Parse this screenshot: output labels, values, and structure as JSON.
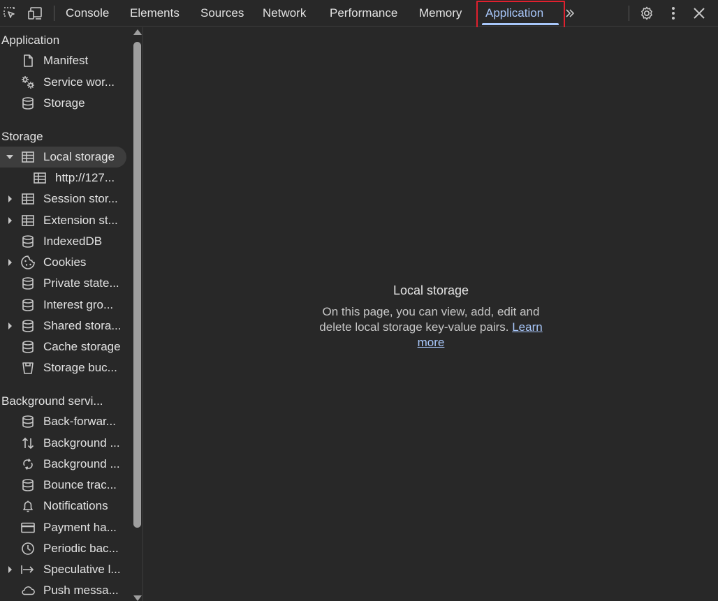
{
  "toolbar": {
    "tabs": [
      {
        "label": "Console"
      },
      {
        "label": "Elements"
      },
      {
        "label": "Sources"
      },
      {
        "label": "Network"
      },
      {
        "label": "Performance"
      },
      {
        "label": "Memory"
      },
      {
        "label": "Application",
        "active": true
      }
    ],
    "icons": {
      "inspect": "inspect-element-icon",
      "device": "device-toolbar-icon",
      "more_tabs": "chevron-double-right-icon",
      "settings": "gear-icon",
      "menu": "kebab-menu-icon",
      "close": "close-icon"
    },
    "accent_color": "#a8c7fa",
    "highlight_color": "#e0202e"
  },
  "sidebar": {
    "sections": [
      {
        "header": "Application",
        "items": [
          {
            "label": "Manifest",
            "icon": "document-icon"
          },
          {
            "label": "Service wor...",
            "icon": "gears-icon"
          },
          {
            "label": "Storage",
            "icon": "database-icon"
          }
        ]
      },
      {
        "header": "Storage",
        "items": [
          {
            "label": "Local storage",
            "icon": "table-icon",
            "expanded": true,
            "selected": true
          },
          {
            "label": "http://127...",
            "icon": "table-icon",
            "child": true
          },
          {
            "label": "Session stor...",
            "icon": "table-icon",
            "collapsed": true
          },
          {
            "label": "Extension st...",
            "icon": "table-icon",
            "collapsed": true
          },
          {
            "label": "IndexedDB",
            "icon": "database-icon"
          },
          {
            "label": "Cookies",
            "icon": "cookie-icon",
            "collapsed": true
          },
          {
            "label": "Private state...",
            "icon": "database-icon"
          },
          {
            "label": "Interest gro...",
            "icon": "database-icon"
          },
          {
            "label": "Shared stora...",
            "icon": "database-icon",
            "collapsed": true
          },
          {
            "label": "Cache storage",
            "icon": "database-icon"
          },
          {
            "label": "Storage buc...",
            "icon": "bucket-icon"
          }
        ]
      },
      {
        "header": "Background servi...",
        "items": [
          {
            "label": "Back-forwar...",
            "icon": "database-icon"
          },
          {
            "label": "Background ...",
            "icon": "up-down-arrows-icon"
          },
          {
            "label": "Background ...",
            "icon": "sync-icon"
          },
          {
            "label": "Bounce trac...",
            "icon": "database-icon"
          },
          {
            "label": "Notifications",
            "icon": "bell-icon"
          },
          {
            "label": "Payment ha...",
            "icon": "credit-card-icon"
          },
          {
            "label": "Periodic bac...",
            "icon": "clock-icon"
          },
          {
            "label": "Speculative l...",
            "icon": "arrow-right-bar-icon",
            "collapsed": true
          },
          {
            "label": "Push messa...",
            "icon": "cloud-icon"
          }
        ]
      }
    ]
  },
  "main": {
    "title": "Local storage",
    "body": "On this page, you can view, add, edit and delete local storage key-value pairs.",
    "link": "Learn more"
  }
}
